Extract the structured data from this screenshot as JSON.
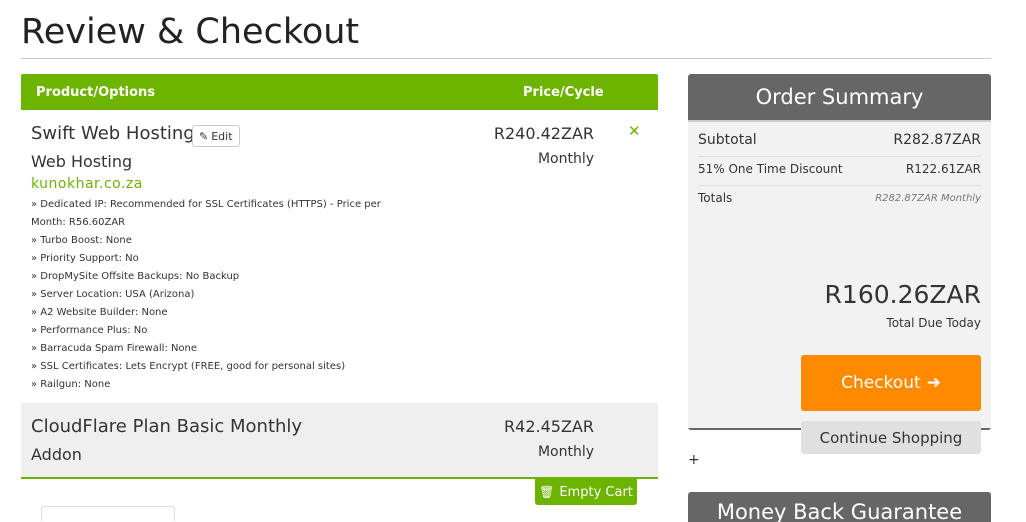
{
  "page": {
    "title": "Review & Checkout"
  },
  "cart": {
    "header": {
      "product_col": "Product/Options",
      "price_col": "Price/Cycle"
    },
    "items": [
      {
        "name": "Swift Web Hosting",
        "edit_label": "Edit",
        "group": "Web Hosting",
        "domain": "kunokhar.co.za",
        "price": "R240.42ZAR",
        "cycle": "Monthly",
        "options": [
          "» Dedicated IP: Recommended for SSL Certificates (HTTPS) - Price per Month: R56.60ZAR",
          "» Turbo Boost: None",
          "» Priority Support: No",
          "» DropMySite Offsite Backups: No Backup",
          "» Server Location: USA (Arizona)",
          "» A2 Website Builder: None",
          "» Performance Plus: No",
          "» Barracuda Spam Firewall: None",
          "» SSL Certificates: Lets Encrypt (FREE, good for personal sites)",
          "» Railgun: None"
        ]
      },
      {
        "name": "CloudFlare Plan Basic Monthly",
        "group": "Addon",
        "price": "R42.45ZAR",
        "cycle": "Monthly"
      }
    ],
    "empty_cart_label": "Empty Cart"
  },
  "summary": {
    "title": "Order Summary",
    "subtotal_label": "Subtotal",
    "subtotal_value": "R282.87ZAR",
    "discount_label": "51% One Time Discount",
    "discount_value": "R122.61ZAR",
    "totals_label": "Totals",
    "totals_value": "R282.87ZAR Monthly",
    "total_due": "R160.26ZAR",
    "total_due_label": "Total Due Today",
    "checkout_label": "Checkout",
    "continue_label": "Continue Shopping"
  },
  "extra": {
    "plus": "+",
    "money_back_title": "Money Back Guarantee"
  },
  "colors": {
    "accent_green": "#6cb400",
    "checkout_orange": "#ff8a00",
    "summary_grey": "#666666"
  }
}
